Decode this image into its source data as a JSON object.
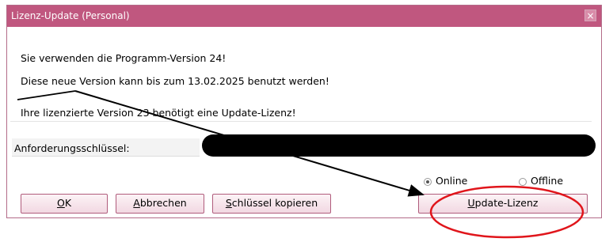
{
  "dialog": {
    "title": "Lizenz-Update (Personal)",
    "close_label": "×"
  },
  "messages": {
    "line1": "Sie verwenden die Programm-Version 24!",
    "line2": "Diese neue Version kann bis zum 13.02.2025 benutzt werden!",
    "line3": "Ihre lizenzierte Version 23 benötigt eine Update-Lizenz!"
  },
  "request_key": {
    "label": "Anforderungsschlüssel:",
    "value_redacted": true
  },
  "mode": {
    "online_label": "Online",
    "offline_label": "Offline",
    "selected": "Online"
  },
  "buttons": {
    "ok": {
      "accel": "O",
      "rest": "K"
    },
    "cancel": {
      "accel": "A",
      "rest": "bbrechen"
    },
    "copy_key": {
      "accel": "S",
      "rest": "chlüssel kopieren"
    },
    "update_license": {
      "accel": "U",
      "rest": "pdate-Lizenz"
    }
  },
  "colors": {
    "titlebar": "#c0577f",
    "button_border": "#b05c7c",
    "annotation": "#e0151b"
  }
}
